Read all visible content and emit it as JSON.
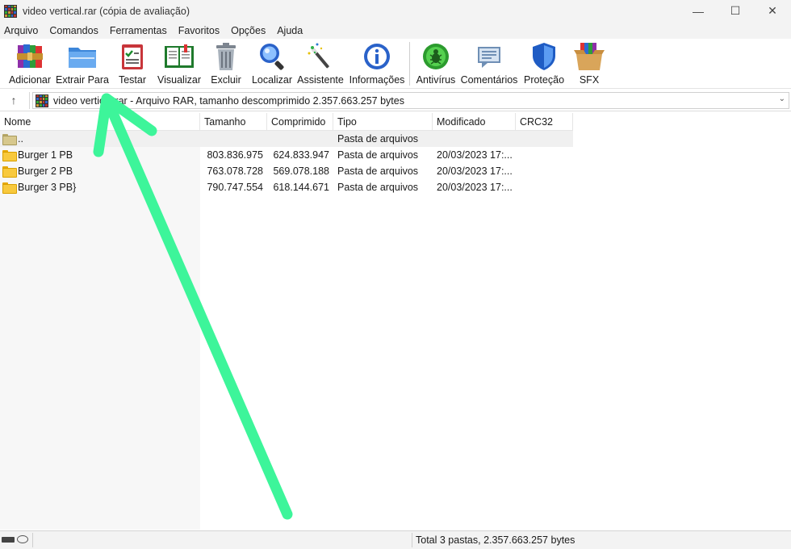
{
  "window": {
    "title": "video vertical.rar (cópia de avaliação)",
    "controls": {
      "minimize": "—",
      "maximize": "☐",
      "close": "✕"
    }
  },
  "menu": [
    "Arquivo",
    "Comandos",
    "Ferramentas",
    "Favoritos",
    "Opções",
    "Ajuda"
  ],
  "toolbar": [
    {
      "label": "Adicionar",
      "icon": "archive-books-icon"
    },
    {
      "label": "Extrair Para",
      "icon": "folder-extract-icon"
    },
    {
      "label": "Testar",
      "icon": "clipboard-check-icon"
    },
    {
      "label": "Visualizar",
      "icon": "open-book-icon"
    },
    {
      "label": "Excluir",
      "icon": "trash-bin-icon"
    },
    {
      "label": "Localizar",
      "icon": "magnifier-icon"
    },
    {
      "label": "Assistente",
      "icon": "magic-wand-icon"
    },
    {
      "label": "Informações",
      "icon": "info-icon"
    },
    {
      "label": "Antivírus",
      "icon": "bug-shield-icon"
    },
    {
      "label": "Comentários",
      "icon": "comment-icon"
    },
    {
      "label": "Proteção",
      "icon": "shield-icon"
    },
    {
      "label": "SFX",
      "icon": "sfx-box-icon"
    }
  ],
  "address": {
    "path": "video vertical.rar - Arquivo RAR, tamanho descomprimido 2.357.663.257 bytes"
  },
  "columns": [
    "Nome",
    "Tamanho",
    "Comprimido",
    "Tipo",
    "Modificado",
    "CRC32"
  ],
  "rows": [
    {
      "name": "..",
      "size": "",
      "packed": "",
      "type": "Pasta de arquivos",
      "modified": "",
      "crc": ""
    },
    {
      "name": "Burger 1 PB",
      "size": "803.836.975",
      "packed": "624.833.947",
      "type": "Pasta de arquivos",
      "modified": "20/03/2023 17:...",
      "crc": ""
    },
    {
      "name": "Burger 2 PB",
      "size": "763.078.728",
      "packed": "569.078.188",
      "type": "Pasta de arquivos",
      "modified": "20/03/2023 17:...",
      "crc": ""
    },
    {
      "name": "Burger 3 PB}",
      "size": "790.747.554",
      "packed": "618.144.671",
      "type": "Pasta de arquivos",
      "modified": "20/03/2023 17:...",
      "crc": ""
    }
  ],
  "status": {
    "text": "Total 3 pastas, 2.357.663.257 bytes"
  },
  "colors": {
    "annotation_arrow": "#3df59a",
    "menu_bg": "#f3f3f3"
  }
}
